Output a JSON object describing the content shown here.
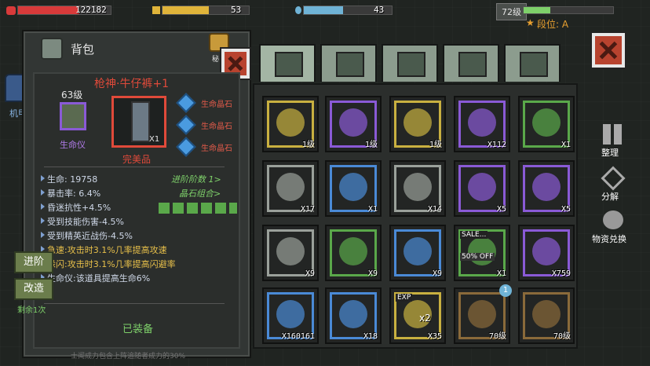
{
  "hud": {
    "hp": "122182",
    "energy": "53",
    "mana": "43",
    "level": "72级",
    "rank": "段位: A"
  },
  "colors": {
    "hp": "#d83a3a",
    "energy": "#e0b43a",
    "mana": "#6fb3d6",
    "exp": "#7ed06a",
    "stat_blue": "#7fa0d0",
    "red": "#e04a3a",
    "green": "#7ed06a",
    "orange": "#e8c04a"
  },
  "bag": {
    "title": "背包",
    "left_tab": "机甲",
    "item_name": "枪神·牛仔裤+1",
    "level": "63级",
    "life_meter": "生命仪",
    "item_count": "X1",
    "quality": "完美品",
    "gems": [
      "生命晶石",
      "生命晶石",
      "生命晶石"
    ],
    "advance_link": "进阶阶数 1>",
    "gem_combo": "晶石组合>",
    "stats": [
      {
        "text": "生命: 19758",
        "color": "#cfd8e8"
      },
      {
        "text": "暴击率: 6.4%",
        "color": "#cfd8e8"
      },
      {
        "text": "昏迷抗性+4.5%",
        "color": "#cfd8e8"
      },
      {
        "text": "受到技能伤害-4.5%",
        "color": "#cfd8e8"
      },
      {
        "text": "受到精英近战伤-4.5%",
        "color": "#cfd8e8"
      },
      {
        "text": "急速:攻击时3.1%几率提高攻速",
        "color": "#e8c04a"
      },
      {
        "text": "躲闪:攻击时3.1%几率提高闪避率",
        "color": "#e8c04a"
      },
      {
        "text": "生命仪:该道具提高生命6%",
        "color": "#cfd8e8"
      }
    ],
    "btn_advance": "进阶",
    "btn_modify": "改造",
    "remaining": "剩余1次",
    "equipped": "已装备",
    "footer": "士闻成力包含上阵追随者成力的30%"
  },
  "sidebar": {
    "sort": "整理",
    "decompose": "分解",
    "exchange": "物资兑换",
    "seal": "秘"
  },
  "tabs": [
    "backpack-icon",
    "medkit-icon",
    "armor-icon",
    "gun-icon",
    "parts-icon"
  ],
  "items": [
    {
      "count": "1级",
      "color": "#c8b040"
    },
    {
      "count": "1级",
      "color": "#8a5ad6"
    },
    {
      "count": "1级",
      "color": "#c8b040"
    },
    {
      "count": "X112",
      "color": "#8a5ad6"
    },
    {
      "count": "X1",
      "color": "#5aa84a"
    },
    {
      "count": "X17",
      "color": "#9aa09a"
    },
    {
      "count": "X1",
      "color": "#4a8ad6"
    },
    {
      "count": "X14",
      "color": "#9aa09a"
    },
    {
      "count": "X5",
      "color": "#8a5ad6"
    },
    {
      "count": "X5",
      "color": "#8a5ad6"
    },
    {
      "count": "X9",
      "color": "#9aa09a"
    },
    {
      "count": "X9",
      "color": "#5aa84a"
    },
    {
      "count": "X9",
      "color": "#4a8ad6"
    },
    {
      "count": "X1",
      "color": "#5aa84a",
      "label": "SALE...",
      "badge": "50% OFF"
    },
    {
      "count": "X759",
      "color": "#8a5ad6"
    },
    {
      "count": "X160161",
      "color": "#4a8ad6"
    },
    {
      "count": "X18",
      "color": "#4a8ad6"
    },
    {
      "count": "X35",
      "color": "#c8b040",
      "label": "EXP",
      "mult": "x2"
    },
    {
      "count": "70级",
      "color": "#8a6a3a",
      "notif": "1"
    },
    {
      "count": "70级",
      "color": "#8a6a3a"
    }
  ]
}
